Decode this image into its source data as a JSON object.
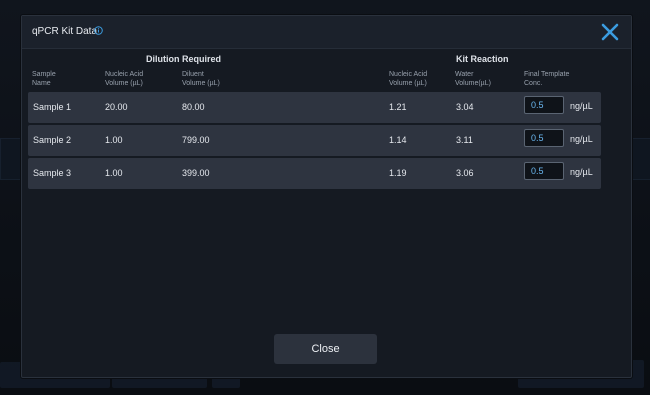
{
  "dialog": {
    "title": "qPCR Kit Data",
    "icons": {
      "info": "info-icon",
      "close": "close-icon"
    },
    "group_headers": {
      "dilution": "Dilution Required",
      "kit": "Kit Reaction"
    },
    "columns": {
      "sample_name": [
        "Sample",
        "Name"
      ],
      "nucleic_acid": [
        "Nucleic Acid",
        "Volume (µL)"
      ],
      "diluent": [
        "Diluent",
        "Volume (µL)"
      ],
      "kit_nucleic_acid": [
        "Nucleic Acid",
        "Volume (µL)"
      ],
      "water": [
        "Water",
        "Volume(µL)"
      ],
      "final_conc": [
        "Final Template",
        "Conc."
      ]
    },
    "rows": [
      {
        "sample": "Sample 1",
        "nucleic": "20.00",
        "diluent": "80.00",
        "kit_nucleic": "1.21",
        "water": "3.04",
        "conc": "0.5",
        "unit": "ng/µL"
      },
      {
        "sample": "Sample 2",
        "nucleic": "1.00",
        "diluent": "799.00",
        "kit_nucleic": "1.14",
        "water": "3.11",
        "conc": "0.5",
        "unit": "ng/µL"
      },
      {
        "sample": "Sample 3",
        "nucleic": "1.00",
        "diluent": "399.00",
        "kit_nucleic": "1.19",
        "water": "3.06",
        "conc": "0.5",
        "unit": "ng/µL"
      }
    ],
    "close_button_label": "Close"
  },
  "colors": {
    "accent": "#3b9de1",
    "row_bg": "#2e3440",
    "dialog_bg": "#151a22"
  }
}
